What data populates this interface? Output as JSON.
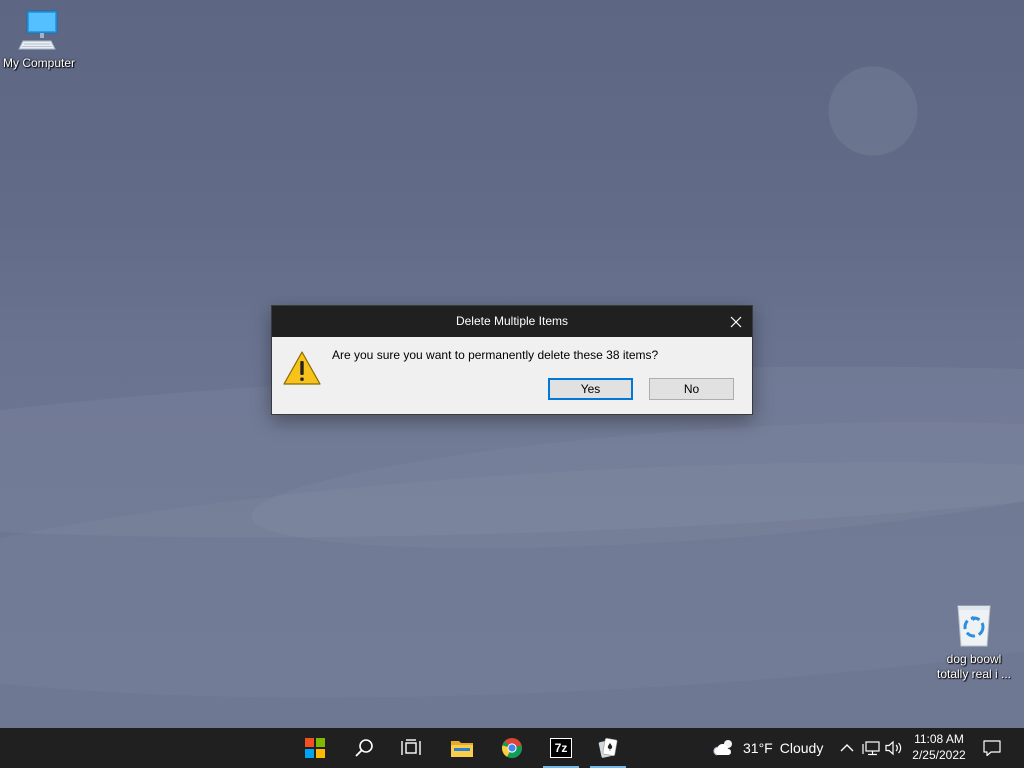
{
  "desktop": {
    "icons": [
      {
        "label": "My Computer",
        "icon": "computer-icon"
      },
      {
        "label": "dog boowl totally real i ...",
        "line1": "dog boowl",
        "line2": "totally real i ...",
        "icon": "recycle-bin-icon"
      }
    ]
  },
  "dialog": {
    "title": "Delete Multiple Items",
    "message": "Are you sure you want to permanently delete these 38 items?",
    "icon": "warning-icon",
    "yes_label": "Yes",
    "no_label": "No",
    "close_icon": "close-icon"
  },
  "taskbar": {
    "apps": [
      {
        "name": "Start",
        "icon": "windows-start-icon"
      },
      {
        "name": "Search",
        "icon": "search-icon"
      },
      {
        "name": "Task View",
        "icon": "task-view-icon"
      },
      {
        "name": "File Explorer",
        "icon": "folder-icon"
      },
      {
        "name": "Chrome",
        "icon": "chrome-icon"
      },
      {
        "name": "7-Zip",
        "icon": "7zip-icon",
        "label": "7z",
        "active": true
      },
      {
        "name": "Solitaire",
        "icon": "cards-icon",
        "active": true
      }
    ],
    "weather": {
      "temp": "31°F",
      "condition": "Cloudy",
      "icon": "cloud-sun-icon"
    },
    "tray": [
      "chevron-up-icon",
      "network-icon",
      "volume-icon"
    ],
    "clock": {
      "time": "11:08 AM",
      "date": "2/25/2022"
    },
    "notification_icon": "notification-icon"
  },
  "colors": {
    "taskbar": "#202020",
    "accent": "#0078d7",
    "desktop": "#6b7590"
  }
}
